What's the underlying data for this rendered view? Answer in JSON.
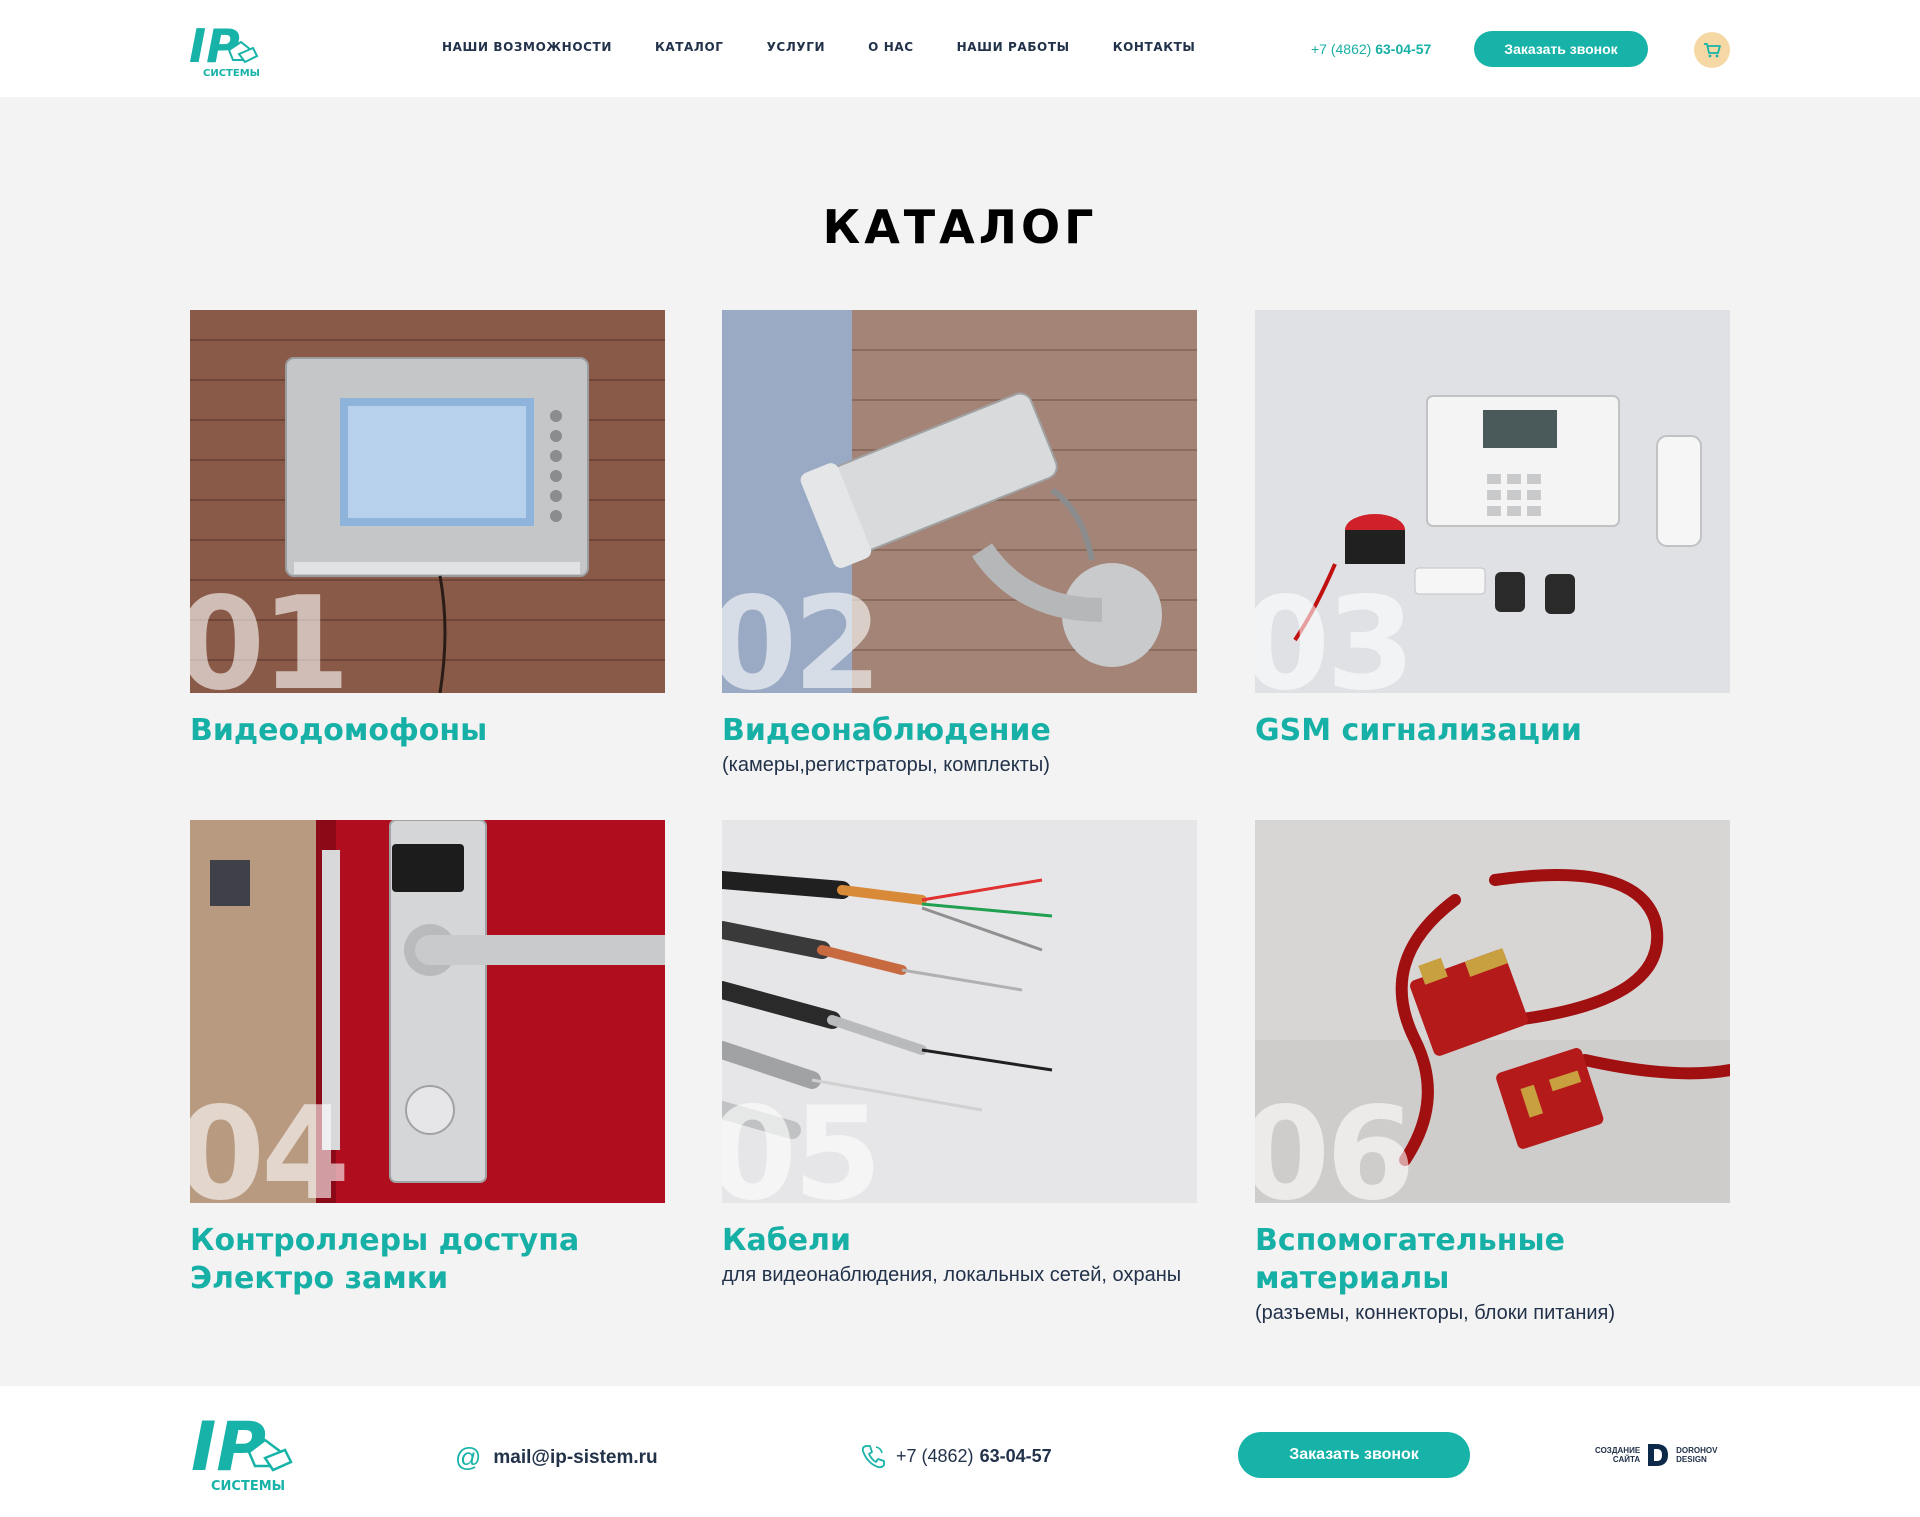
{
  "header": {
    "logo_text": "IP",
    "logo_sub": "СИСТЕМЫ",
    "nav": [
      "НАШИ ВОЗМОЖНОСТИ",
      "КАТАЛОГ",
      "УСЛУГИ",
      "О НАС",
      "НАШИ РАБОТЫ",
      "КОНТАКТЫ"
    ],
    "phone_prefix": "+7 (4862)",
    "phone_number": "63-04-57",
    "call_button": "Заказать звонок",
    "cart_icon": "cart-icon"
  },
  "main": {
    "title": "КАТАЛОГ",
    "cards": [
      {
        "num": "01",
        "title": "Видеодомофоны",
        "sub": ""
      },
      {
        "num": "02",
        "title": "Видеонаблюдение",
        "sub": "(камеры,регистраторы, комплекты)"
      },
      {
        "num": "03",
        "title": "GSM сигнализации",
        "sub": ""
      },
      {
        "num": "04",
        "title": "Контроллеры доступа Электро замки",
        "sub": ""
      },
      {
        "num": "05",
        "title": "Кабели",
        "sub": "для видеонаблюдения, локальных сетей, охраны"
      },
      {
        "num": "06",
        "title": "Вспомогательные материалы",
        "sub": "(разъемы, коннекторы, блоки питания)"
      }
    ]
  },
  "footer": {
    "logo_text": "IP",
    "logo_sub": "СИСТЕМЫ",
    "email": "mail@ip-sistem.ru",
    "phone_prefix": "+7 (4862)",
    "phone_number": "63-04-57",
    "call_button": "Заказать звонок",
    "credit_left_1": "СОЗДАНИЕ",
    "credit_left_2": "САЙТА",
    "credit_right_1": "DOROHOV",
    "credit_right_2": "DESIGN"
  },
  "colors": {
    "accent": "#17b3a8",
    "text_dark": "#22324a",
    "background": "#f3f3f3",
    "cart_bg": "#f6d8a5"
  }
}
